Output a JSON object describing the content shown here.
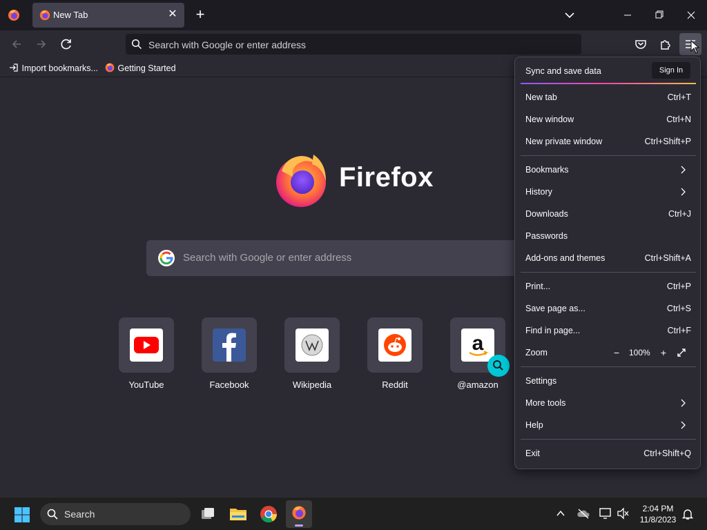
{
  "browser": {
    "tab": {
      "title": "New Tab"
    },
    "url_placeholder": "Search with Google or enter address",
    "bookmarks": [
      {
        "label": "Import bookmarks..."
      },
      {
        "label": "Getting Started"
      }
    ]
  },
  "newtab": {
    "brand": "Firefox",
    "search_placeholder": "Search with Google or enter address",
    "top_sites": [
      {
        "name": "YouTube"
      },
      {
        "name": "Facebook"
      },
      {
        "name": "Wikipedia"
      },
      {
        "name": "Reddit"
      },
      {
        "name": "@amazon"
      }
    ]
  },
  "menu": {
    "sync_label": "Sync and save data",
    "signin_label": "Sign In",
    "items": [
      {
        "label": "New tab",
        "shortcut": "Ctrl+T"
      },
      {
        "label": "New window",
        "shortcut": "Ctrl+N"
      },
      {
        "label": "New private window",
        "shortcut": "Ctrl+Shift+P"
      },
      {
        "label": "Bookmarks",
        "shortcut": ""
      },
      {
        "label": "History",
        "shortcut": ""
      },
      {
        "label": "Downloads",
        "shortcut": "Ctrl+J"
      },
      {
        "label": "Passwords",
        "shortcut": ""
      },
      {
        "label": "Add-ons and themes",
        "shortcut": "Ctrl+Shift+A"
      },
      {
        "label": "Print...",
        "shortcut": "Ctrl+P"
      },
      {
        "label": "Save page as...",
        "shortcut": "Ctrl+S"
      },
      {
        "label": "Find in page...",
        "shortcut": "Ctrl+F"
      },
      {
        "label": "Zoom",
        "shortcut": ""
      },
      {
        "label": "Settings",
        "shortcut": ""
      },
      {
        "label": "More tools",
        "shortcut": ""
      },
      {
        "label": "Help",
        "shortcut": ""
      },
      {
        "label": "Exit",
        "shortcut": "Ctrl+Shift+Q"
      }
    ],
    "zoom_level": "100%"
  },
  "taskbar": {
    "search_label": "Search",
    "time": "2:04 PM",
    "date": "11/8/2023"
  },
  "colors": {
    "accent_cyan": "#00c8d7",
    "menu_bg": "#2b2a33",
    "toolbar_bg": "#1c1b22"
  }
}
